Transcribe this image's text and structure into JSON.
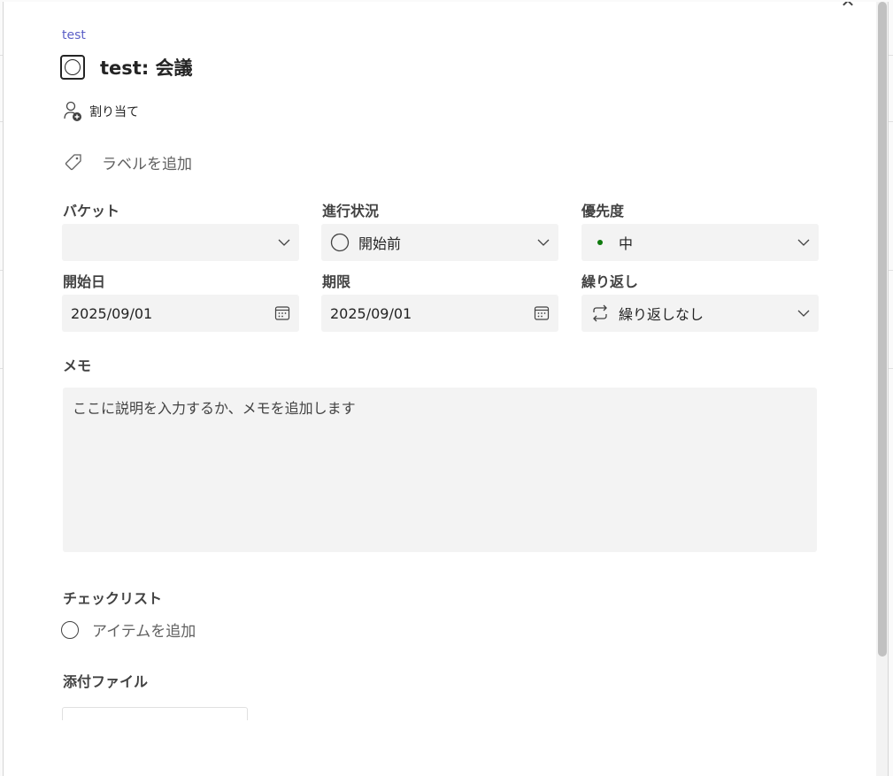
{
  "plan_name": "test",
  "task_title": "test: 会議",
  "assign_label": "割り当て",
  "add_label_text": "ラベルを追加",
  "fields": {
    "bucket": {
      "label": "バケット",
      "value": ""
    },
    "progress": {
      "label": "進行状況",
      "value": "開始前"
    },
    "priority": {
      "label": "優先度",
      "value": "中",
      "color": "#0e7a0d"
    },
    "start_date": {
      "label": "開始日",
      "value": "2025/09/01"
    },
    "due_date": {
      "label": "期限",
      "value": "2025/09/01"
    },
    "repeat": {
      "label": "繰り返し",
      "value": "繰り返しなし"
    }
  },
  "notes": {
    "label": "メモ",
    "placeholder": "ここに説明を入力するか、メモを追加します"
  },
  "checklist": {
    "label": "チェックリスト",
    "add_item": "アイテムを追加"
  },
  "attachments": {
    "label": "添付ファイル"
  },
  "accent_color": "#5b5fc7",
  "icons": [
    "close-icon",
    "task-complete-icon",
    "assign-person-icon",
    "tag-icon",
    "chevron-down-icon",
    "calendar-icon",
    "circle-status-icon",
    "repeat-icon"
  ]
}
